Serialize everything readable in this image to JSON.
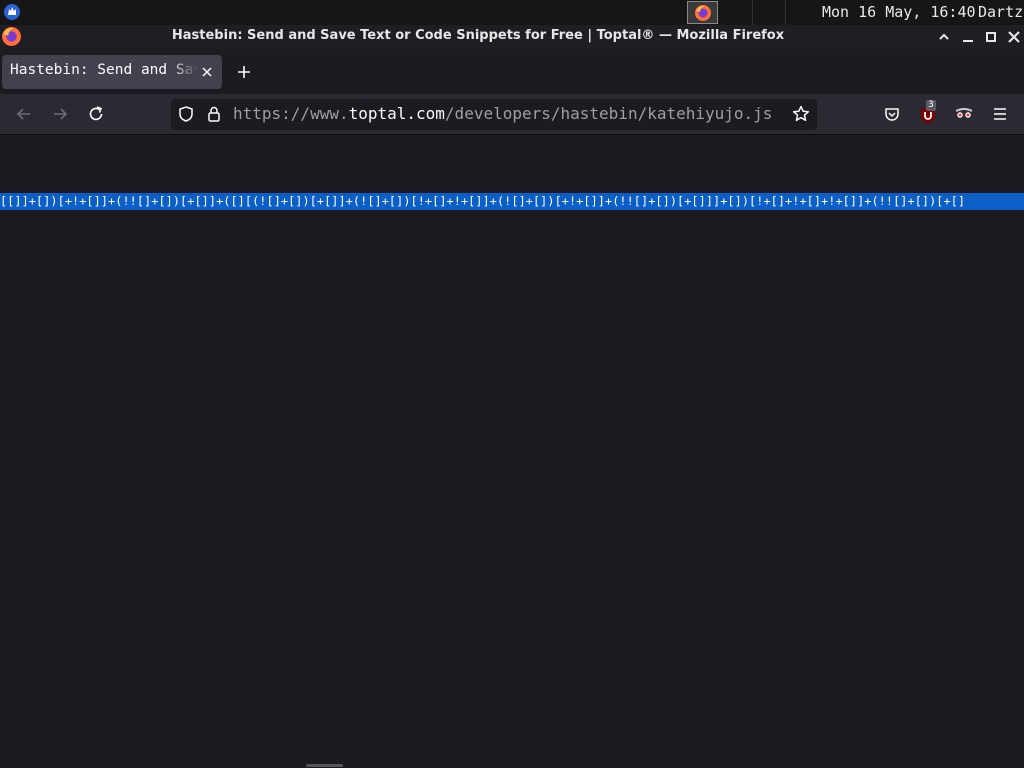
{
  "os_panel": {
    "clock": "Mon 16 May, 16:40",
    "user": "Dartz",
    "menu_icon": "app-menu-icon",
    "taskbar_item_icon": "firefox-icon"
  },
  "window": {
    "title": "Hastebin: Send and Save Text or Code Snippets for Free | Toptal® — Mozilla Firefox",
    "controls": [
      "minimize-up-icon",
      "minimize-icon",
      "maximize-icon",
      "close-icon"
    ]
  },
  "tab": {
    "label": "Hastebin: Send and Save Text or Code Snippets for Free | Toptal®",
    "close_icon": "close-icon",
    "new_tab_icon": "plus-icon"
  },
  "navbar": {
    "url_prefix": "https://www.",
    "url_domain": "toptal.com",
    "url_path": "/developers/hastebin/katehiyujo.js",
    "ublock_badge": "3",
    "icons": [
      "back-icon",
      "forward-icon",
      "reload-icon",
      "shield-icon",
      "lock-icon",
      "bookmark-star-icon",
      "pocket-icon",
      "ublock-icon",
      "extension-mask-icon",
      "hamburger-menu-icon"
    ]
  },
  "content": {
    "selected_line": "[[]]+[])[+!+[]]+(!![]+[])[+[]]+([][(![]+[])[+[]]+(![]+[])[!+[]+!+[]]+(![]+[])[+!+[]]+(!![]+[])[+[]]]+[])[!+[]+!+[]+!+[]]+(!![]+[])[+[]"
  },
  "colors": {
    "background": "#1c1b22",
    "navbar": "#2b2a33",
    "selection": "#0c5fc6"
  }
}
